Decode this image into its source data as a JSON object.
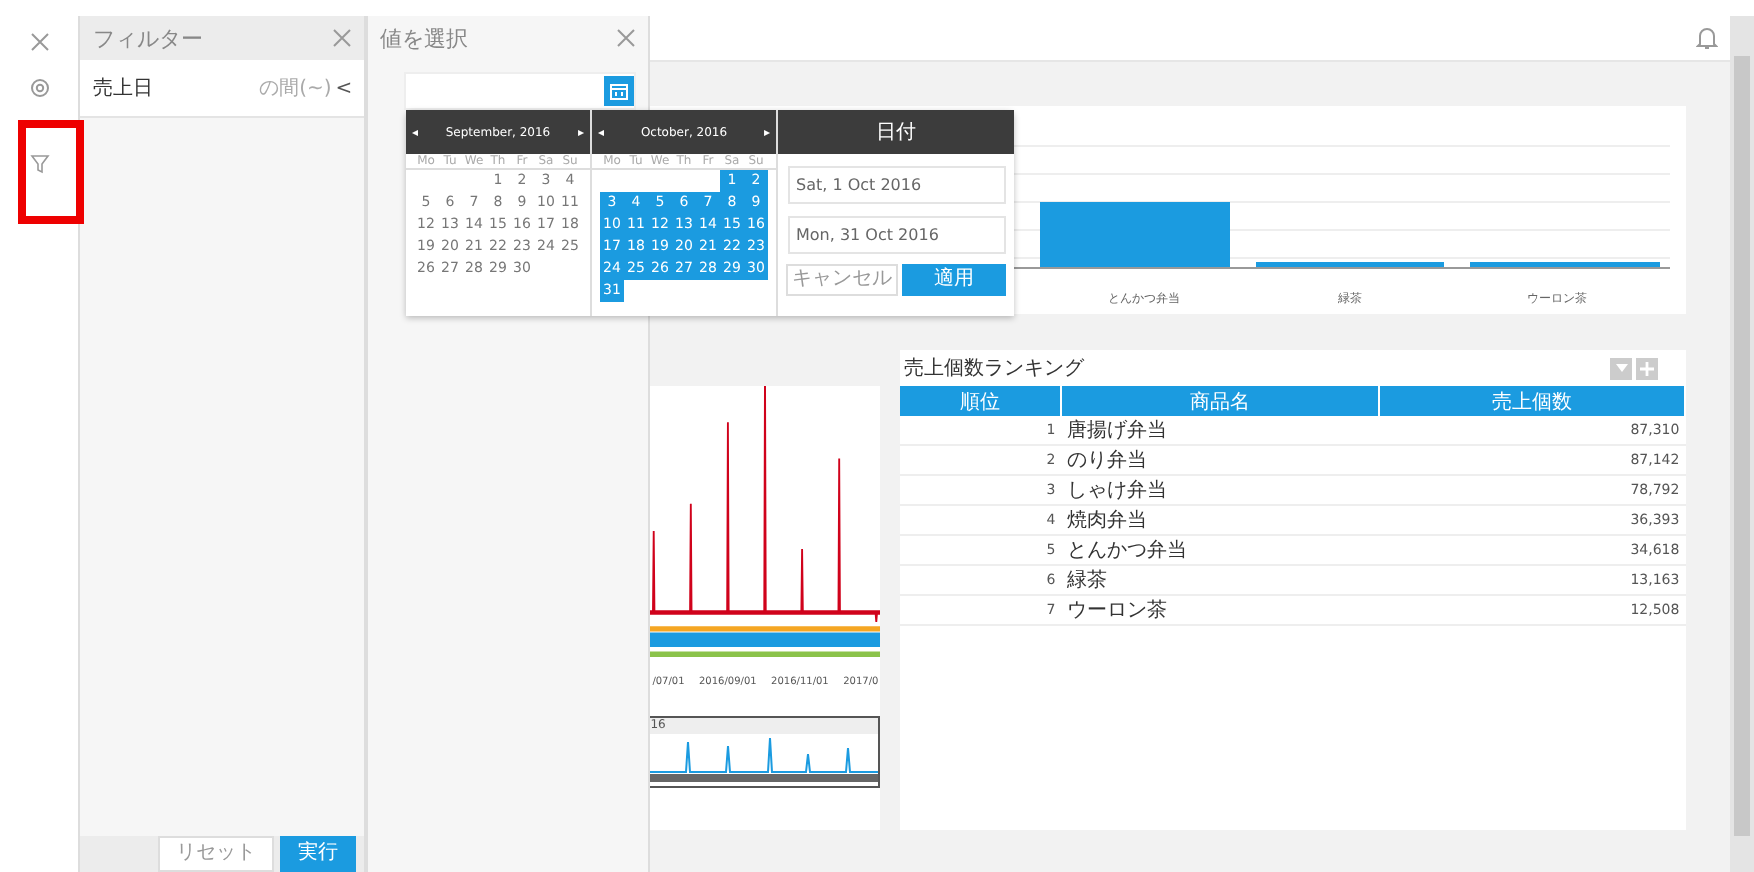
{
  "filter_panel": {
    "title": "フィルター",
    "fields": [
      {
        "label": "売上日",
        "operator": "の間(~)",
        "chevron": "<"
      }
    ],
    "buttons": [
      {
        "label": "リセット",
        "kind": "secondary"
      },
      {
        "label": "実行",
        "kind": "primary"
      }
    ]
  },
  "value_panel": {
    "title": "値を選択"
  },
  "date_picker": {
    "months": [
      {
        "title": "September, 2016",
        "prev": "◂",
        "next": "▸",
        "weekdays": [
          "Mo",
          "Tu",
          "We",
          "Th",
          "Fr",
          "Sa",
          "Su"
        ],
        "weeks": [
          {
            "kind": "trailing",
            "days": [
              {
                "day": "1",
                "selected": false
              },
              {
                "day": "2",
                "selected": false
              },
              {
                "day": "3",
                "selected": false
              },
              {
                "day": "4",
                "selected": false
              }
            ]
          },
          {
            "kind": "full",
            "days": [
              {
                "day": "5",
                "selected": false
              },
              {
                "day": "6",
                "selected": false
              },
              {
                "day": "7",
                "selected": false
              },
              {
                "day": "8",
                "selected": false
              },
              {
                "day": "9",
                "selected": false
              },
              {
                "day": "10",
                "selected": false
              },
              {
                "day": "11",
                "selected": false
              }
            ]
          },
          {
            "kind": "full",
            "days": [
              {
                "day": "12",
                "selected": false
              },
              {
                "day": "13",
                "selected": false
              },
              {
                "day": "14",
                "selected": false
              },
              {
                "day": "15",
                "selected": false
              },
              {
                "day": "16",
                "selected": false
              },
              {
                "day": "17",
                "selected": false
              },
              {
                "day": "18",
                "selected": false
              }
            ]
          },
          {
            "kind": "full",
            "days": [
              {
                "day": "19",
                "selected": false
              },
              {
                "day": "20",
                "selected": false
              },
              {
                "day": "21",
                "selected": false
              },
              {
                "day": "22",
                "selected": false
              },
              {
                "day": "23",
                "selected": false
              },
              {
                "day": "24",
                "selected": false
              },
              {
                "day": "25",
                "selected": false
              }
            ]
          },
          {
            "kind": "full",
            "days": [
              {
                "day": "26",
                "selected": false
              },
              {
                "day": "27",
                "selected": false
              },
              {
                "day": "28",
                "selected": false
              },
              {
                "day": "29",
                "selected": false
              },
              {
                "day": "30",
                "selected": false
              }
            ]
          }
        ]
      },
      {
        "title": "October, 2016",
        "prev": "◂",
        "next": "▸",
        "weekdays": [
          "Mo",
          "Tu",
          "We",
          "Th",
          "Fr",
          "Sa",
          "Su"
        ],
        "weeks": [
          {
            "kind": "trailing",
            "days": [
              {
                "day": "1",
                "selected": true
              },
              {
                "day": "2",
                "selected": true
              }
            ]
          },
          {
            "kind": "full",
            "days": [
              {
                "day": "3",
                "selected": true
              },
              {
                "day": "4",
                "selected": true
              },
              {
                "day": "5",
                "selected": true
              },
              {
                "day": "6",
                "selected": true
              },
              {
                "day": "7",
                "selected": true
              },
              {
                "day": "8",
                "selected": true
              },
              {
                "day": "9",
                "selected": true
              }
            ]
          },
          {
            "kind": "full",
            "days": [
              {
                "day": "10",
                "selected": true
              },
              {
                "day": "11",
                "selected": true
              },
              {
                "day": "12",
                "selected": true
              },
              {
                "day": "13",
                "selected": true
              },
              {
                "day": "14",
                "selected": true
              },
              {
                "day": "15",
                "selected": true
              },
              {
                "day": "16",
                "selected": true
              }
            ]
          },
          {
            "kind": "full",
            "days": [
              {
                "day": "17",
                "selected": true
              },
              {
                "day": "18",
                "selected": true
              },
              {
                "day": "19",
                "selected": true
              },
              {
                "day": "20",
                "selected": true
              },
              {
                "day": "21",
                "selected": true
              },
              {
                "day": "22",
                "selected": true
              },
              {
                "day": "23",
                "selected": true
              }
            ]
          },
          {
            "kind": "full",
            "days": [
              {
                "day": "24",
                "selected": true
              },
              {
                "day": "25",
                "selected": true
              },
              {
                "day": "26",
                "selected": true
              },
              {
                "day": "27",
                "selected": true
              },
              {
                "day": "28",
                "selected": true
              },
              {
                "day": "29",
                "selected": true
              },
              {
                "day": "30",
                "selected": true
              }
            ]
          },
          {
            "kind": "full",
            "days": [
              {
                "day": "31",
                "selected": true
              }
            ]
          }
        ]
      }
    ],
    "range": {
      "title": "日付",
      "start": "Sat, 1 Oct 2016",
      "end": "Mon, 31 Oct 2016",
      "buttons": [
        {
          "label": "キャンセル",
          "kind": "secondary"
        },
        {
          "label": "適用",
          "kind": "primary"
        }
      ]
    }
  },
  "bar_chart": {
    "x_labels": [
      "とんかつ弁当",
      "緑茶",
      "ウーロン茶"
    ]
  },
  "line_chart": {
    "x_labels": [
      "/07/01",
      "2016/09/01",
      "2016/11/01",
      "2017/0"
    ],
    "navigator_label": "16"
  },
  "ranking": {
    "title": "売上個数ランキング",
    "columns": [
      "順位",
      "商品名",
      "売上個数"
    ],
    "rows": [
      {
        "rank": "1",
        "name": "唐揚げ弁当",
        "count": "87,310"
      },
      {
        "rank": "2",
        "name": "のり弁当",
        "count": "87,142"
      },
      {
        "rank": "3",
        "name": "しゃけ弁当",
        "count": "78,792"
      },
      {
        "rank": "4",
        "name": "焼肉弁当",
        "count": "36,393"
      },
      {
        "rank": "5",
        "name": "とんかつ弁当",
        "count": "34,618"
      },
      {
        "rank": "6",
        "name": "緑茶",
        "count": "13,163"
      },
      {
        "rank": "7",
        "name": "ウーロン茶",
        "count": "12,508"
      }
    ]
  }
}
